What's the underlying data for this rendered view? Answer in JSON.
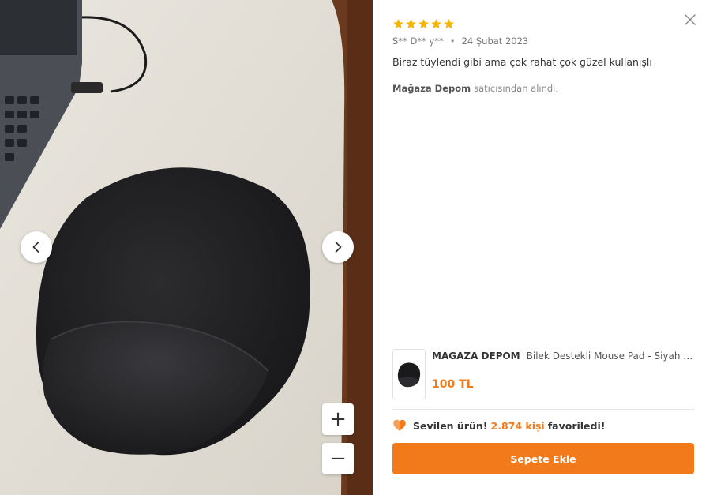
{
  "photo": {
    "alt_subject": "wrist-rest-mouse-pad-photo",
    "prev_icon": "chevron-left-icon",
    "next_icon": "chevron-right-icon",
    "zoom_in_label": "+",
    "zoom_out_label": "−"
  },
  "review": {
    "rating": 5,
    "star_color": "#f5b501",
    "reviewer": "S** D** y**",
    "separator": "•",
    "date": "24 Şubat 2023",
    "comment": "Biraz tüylendi gibi ama çok rahat çok güzel kullanışlı",
    "seller_name": "Mağaza Depom",
    "seller_suffix": "satıcısından alındı."
  },
  "product": {
    "brand": "MAĞAZA DEPOM",
    "name": "Bilek Destekli Mouse Pad - Siyah Oval Bilek Destekli Mouse Pad",
    "price": "100 TL"
  },
  "favorites": {
    "icon": "heart-icon",
    "prefix": "Sevilen ürün!",
    "count_text": "2.874 kişi",
    "suffix": "favoriledi!"
  },
  "actions": {
    "close_icon": "close-icon",
    "add_to_cart": "Sepete Ekle"
  },
  "colors": {
    "accent": "#f27a1a",
    "star": "#f5b501"
  }
}
